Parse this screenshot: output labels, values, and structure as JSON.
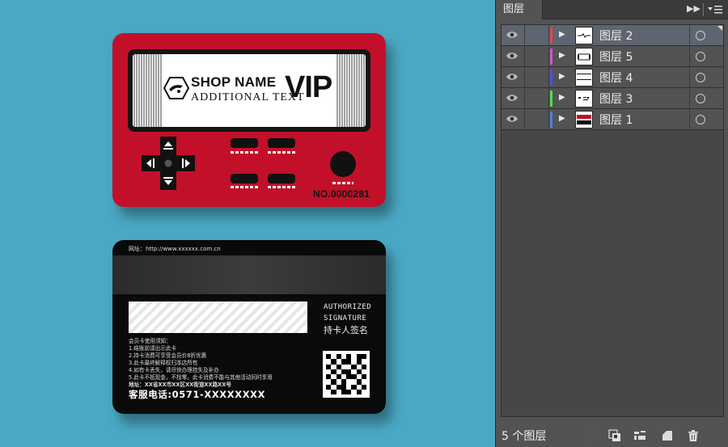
{
  "canvas": {
    "background": "#4aa8c4",
    "front_card": {
      "color": "#c2102a",
      "shop_name": "SHOP NAME",
      "additional_text": "ADDITIONAL TEXT",
      "vip": "VIP",
      "card_number": "NO.0000281"
    },
    "back_card": {
      "website": "网址：http://www.xxxxxx.com.cn",
      "authorized": "AUTHORIZED",
      "signature": "SIGNATURE",
      "cardholder_signature": "持卡人签名",
      "notes_title": "会员卡使用须知：",
      "notes": [
        "1.结账前请出示此卡",
        "2.持卡消费可享受会员价8折优惠",
        "3.此卡最终解释权归本店所有",
        "4.如有卡丢失，请尽快办理挂失及补办",
        "5.此卡不抵现金，不找零。此卡消费不能与其他活动同时享用"
      ],
      "address": "地址：XX省XX市XX区XX街道XX路XX号",
      "hotline": "客服电话:0571-XXXXXXXX"
    }
  },
  "panel": {
    "tab_label": "图层",
    "expand_icon": "double-chevron-right-icon",
    "menu_icon": "panel-menu-icon",
    "layers": [
      {
        "name": "图层 2",
        "color": "#e0474c",
        "active": true
      },
      {
        "name": "图层 5",
        "color": "#d64fd6",
        "active": false
      },
      {
        "name": "图层 4",
        "color": "#4f4fe0",
        "active": false
      },
      {
        "name": "图层 3",
        "color": "#4fe04f",
        "active": false
      },
      {
        "name": "图层 1",
        "color": "#4f7fe0",
        "active": false
      }
    ],
    "layer_count": "5 个图层",
    "footer_icons": [
      "locate-object-icon",
      "clipping-mask-icon",
      "new-sublayer-icon",
      "new-layer-icon",
      "trash-icon"
    ]
  }
}
